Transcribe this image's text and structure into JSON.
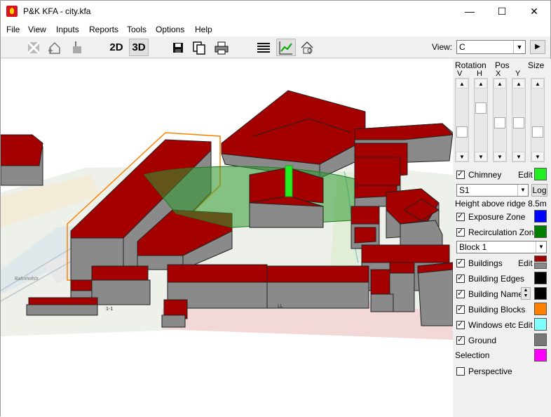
{
  "window": {
    "title": "P&K KFA - city.kfa",
    "minimize": "—",
    "maximize": "☐",
    "close": "✕"
  },
  "menu": [
    "File",
    "View",
    "Inputs",
    "Reports",
    "Tools",
    "Options",
    "Help"
  ],
  "toolbar": {
    "mode_2d": "2D",
    "mode_3d": "3D",
    "view_label": "View:",
    "view_value": "C",
    "go": "▶"
  },
  "panel": {
    "rotation": "Rotation",
    "pos": "Pos",
    "size": "Size",
    "v": "V",
    "h": "H",
    "x": "X",
    "y": "Y",
    "chimney": "Chimney",
    "edit": "Edit",
    "source_value": "S1",
    "log": "Log",
    "height_text": "Height above ridge 8.5m",
    "exposure_zone": "Exposure Zone",
    "recirculation_zone": "Recirculation Zone",
    "block_value": "Block 1",
    "buildings": "Buildings",
    "building_edges": "Building Edges",
    "building_names": "Building Names",
    "building_blocks": "Building Blocks",
    "windows": "Windows etc",
    "ground": "Ground",
    "selection": "Selection",
    "perspective": "Perspective"
  },
  "colors": {
    "chimney": "#22ee22",
    "exposure": "#0000ff",
    "recirculation": "#008000",
    "buildings_top": "#a00000",
    "buildings_side": "#888888",
    "edges": "#000000",
    "names": "#000000",
    "blocks": "#ff8000",
    "windows": "#80ffff",
    "ground": "#777777",
    "selection": "#ff00ff"
  }
}
